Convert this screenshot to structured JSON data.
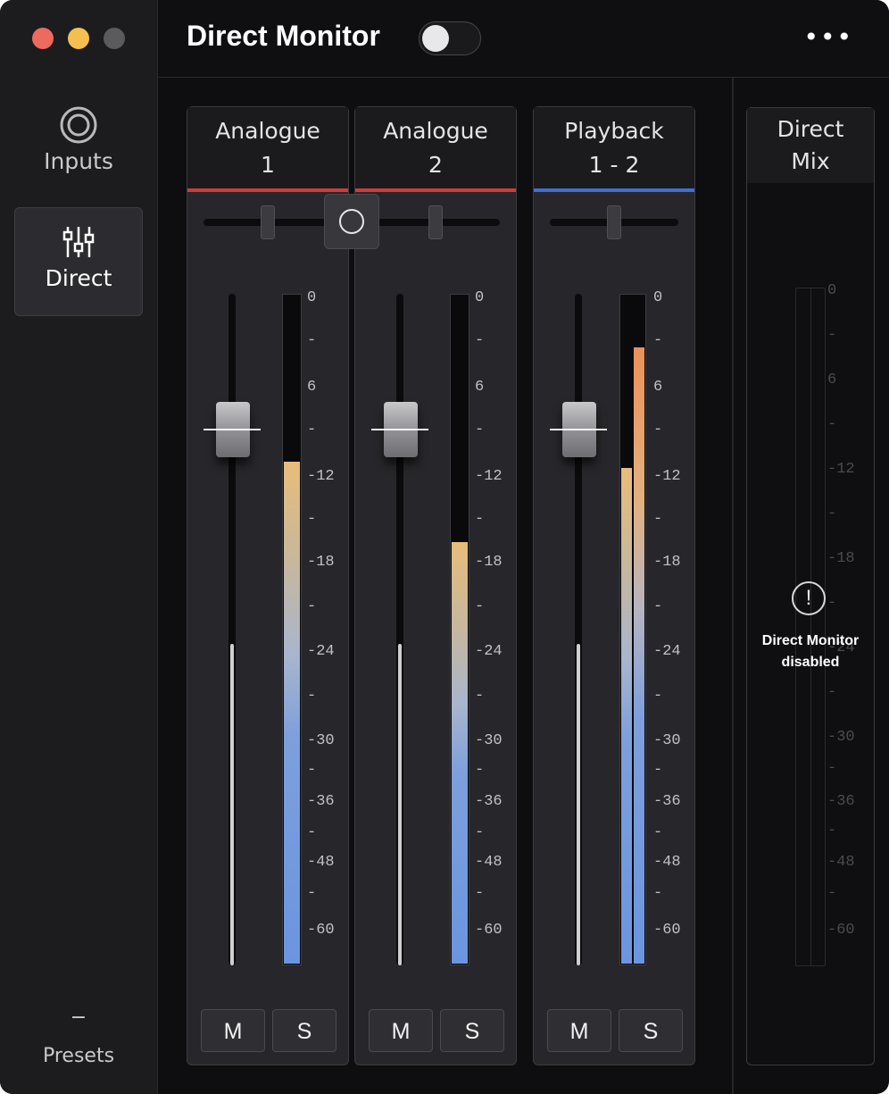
{
  "window": {
    "title": "Direct Monitor",
    "direct_monitor_enabled": false,
    "menu_icon": "more-horizontal-icon"
  },
  "sidebar": {
    "items": [
      {
        "label": "Inputs",
        "icon": "input-ring-icon",
        "selected": false
      },
      {
        "label": "Direct",
        "icon": "mixer-sliders-icon",
        "selected": true
      }
    ],
    "presets": {
      "label": "Presets",
      "icon": "minus"
    }
  },
  "colors": {
    "analogue_accent": "#d23a3a",
    "playback_accent": "#3f6fd6",
    "meter_blue": "#6b95e0",
    "meter_peak": "#e9a24c"
  },
  "scale_labels": [
    "0",
    "-",
    "6",
    "-",
    "-12",
    "-",
    "-18",
    "-",
    "-24",
    "-",
    "-30",
    "-",
    "-36",
    "-",
    "-48",
    "-",
    "-60"
  ],
  "channels": [
    {
      "line1": "Analogue",
      "line2": "1",
      "mute": "M",
      "solo": "S",
      "meter_level": 0.75
    },
    {
      "line1": "Analogue",
      "line2": "2",
      "mute": "M",
      "solo": "S",
      "meter_level": 0.63
    },
    {
      "line1": "Playback",
      "line2": "1 - 2",
      "mute": "M",
      "solo": "S",
      "meter_level_left": 0.74,
      "meter_level_right": 0.92
    }
  ],
  "direct_mix": {
    "line1": "Direct",
    "line2": "Mix",
    "warning_line1": "Direct Monitor",
    "warning_line2": "disabled",
    "warning_icon": "exclamation-circle-icon"
  }
}
